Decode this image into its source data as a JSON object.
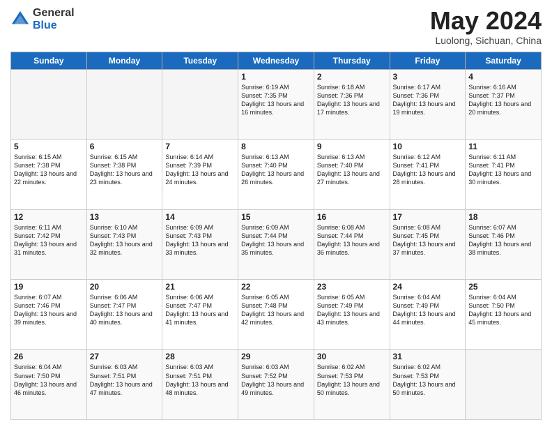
{
  "header": {
    "logo_general": "General",
    "logo_blue": "Blue",
    "month_title": "May 2024",
    "location": "Luolong, Sichuan, China"
  },
  "weekdays": [
    "Sunday",
    "Monday",
    "Tuesday",
    "Wednesday",
    "Thursday",
    "Friday",
    "Saturday"
  ],
  "weeks": [
    [
      {
        "day": "",
        "detail": ""
      },
      {
        "day": "",
        "detail": ""
      },
      {
        "day": "",
        "detail": ""
      },
      {
        "day": "1",
        "detail": "Sunrise: 6:19 AM\nSunset: 7:35 PM\nDaylight: 13 hours\nand 16 minutes."
      },
      {
        "day": "2",
        "detail": "Sunrise: 6:18 AM\nSunset: 7:36 PM\nDaylight: 13 hours\nand 17 minutes."
      },
      {
        "day": "3",
        "detail": "Sunrise: 6:17 AM\nSunset: 7:36 PM\nDaylight: 13 hours\nand 19 minutes."
      },
      {
        "day": "4",
        "detail": "Sunrise: 6:16 AM\nSunset: 7:37 PM\nDaylight: 13 hours\nand 20 minutes."
      }
    ],
    [
      {
        "day": "5",
        "detail": "Sunrise: 6:15 AM\nSunset: 7:38 PM\nDaylight: 13 hours\nand 22 minutes."
      },
      {
        "day": "6",
        "detail": "Sunrise: 6:15 AM\nSunset: 7:38 PM\nDaylight: 13 hours\nand 23 minutes."
      },
      {
        "day": "7",
        "detail": "Sunrise: 6:14 AM\nSunset: 7:39 PM\nDaylight: 13 hours\nand 24 minutes."
      },
      {
        "day": "8",
        "detail": "Sunrise: 6:13 AM\nSunset: 7:40 PM\nDaylight: 13 hours\nand 26 minutes."
      },
      {
        "day": "9",
        "detail": "Sunrise: 6:13 AM\nSunset: 7:40 PM\nDaylight: 13 hours\nand 27 minutes."
      },
      {
        "day": "10",
        "detail": "Sunrise: 6:12 AM\nSunset: 7:41 PM\nDaylight: 13 hours\nand 28 minutes."
      },
      {
        "day": "11",
        "detail": "Sunrise: 6:11 AM\nSunset: 7:41 PM\nDaylight: 13 hours\nand 30 minutes."
      }
    ],
    [
      {
        "day": "12",
        "detail": "Sunrise: 6:11 AM\nSunset: 7:42 PM\nDaylight: 13 hours\nand 31 minutes."
      },
      {
        "day": "13",
        "detail": "Sunrise: 6:10 AM\nSunset: 7:43 PM\nDaylight: 13 hours\nand 32 minutes."
      },
      {
        "day": "14",
        "detail": "Sunrise: 6:09 AM\nSunset: 7:43 PM\nDaylight: 13 hours\nand 33 minutes."
      },
      {
        "day": "15",
        "detail": "Sunrise: 6:09 AM\nSunset: 7:44 PM\nDaylight: 13 hours\nand 35 minutes."
      },
      {
        "day": "16",
        "detail": "Sunrise: 6:08 AM\nSunset: 7:44 PM\nDaylight: 13 hours\nand 36 minutes."
      },
      {
        "day": "17",
        "detail": "Sunrise: 6:08 AM\nSunset: 7:45 PM\nDaylight: 13 hours\nand 37 minutes."
      },
      {
        "day": "18",
        "detail": "Sunrise: 6:07 AM\nSunset: 7:46 PM\nDaylight: 13 hours\nand 38 minutes."
      }
    ],
    [
      {
        "day": "19",
        "detail": "Sunrise: 6:07 AM\nSunset: 7:46 PM\nDaylight: 13 hours\nand 39 minutes."
      },
      {
        "day": "20",
        "detail": "Sunrise: 6:06 AM\nSunset: 7:47 PM\nDaylight: 13 hours\nand 40 minutes."
      },
      {
        "day": "21",
        "detail": "Sunrise: 6:06 AM\nSunset: 7:47 PM\nDaylight: 13 hours\nand 41 minutes."
      },
      {
        "day": "22",
        "detail": "Sunrise: 6:05 AM\nSunset: 7:48 PM\nDaylight: 13 hours\nand 42 minutes."
      },
      {
        "day": "23",
        "detail": "Sunrise: 6:05 AM\nSunset: 7:49 PM\nDaylight: 13 hours\nand 43 minutes."
      },
      {
        "day": "24",
        "detail": "Sunrise: 6:04 AM\nSunset: 7:49 PM\nDaylight: 13 hours\nand 44 minutes."
      },
      {
        "day": "25",
        "detail": "Sunrise: 6:04 AM\nSunset: 7:50 PM\nDaylight: 13 hours\nand 45 minutes."
      }
    ],
    [
      {
        "day": "26",
        "detail": "Sunrise: 6:04 AM\nSunset: 7:50 PM\nDaylight: 13 hours\nand 46 minutes."
      },
      {
        "day": "27",
        "detail": "Sunrise: 6:03 AM\nSunset: 7:51 PM\nDaylight: 13 hours\nand 47 minutes."
      },
      {
        "day": "28",
        "detail": "Sunrise: 6:03 AM\nSunset: 7:51 PM\nDaylight: 13 hours\nand 48 minutes."
      },
      {
        "day": "29",
        "detail": "Sunrise: 6:03 AM\nSunset: 7:52 PM\nDaylight: 13 hours\nand 49 minutes."
      },
      {
        "day": "30",
        "detail": "Sunrise: 6:02 AM\nSunset: 7:53 PM\nDaylight: 13 hours\nand 50 minutes."
      },
      {
        "day": "31",
        "detail": "Sunrise: 6:02 AM\nSunset: 7:53 PM\nDaylight: 13 hours\nand 50 minutes."
      },
      {
        "day": "",
        "detail": ""
      }
    ]
  ]
}
